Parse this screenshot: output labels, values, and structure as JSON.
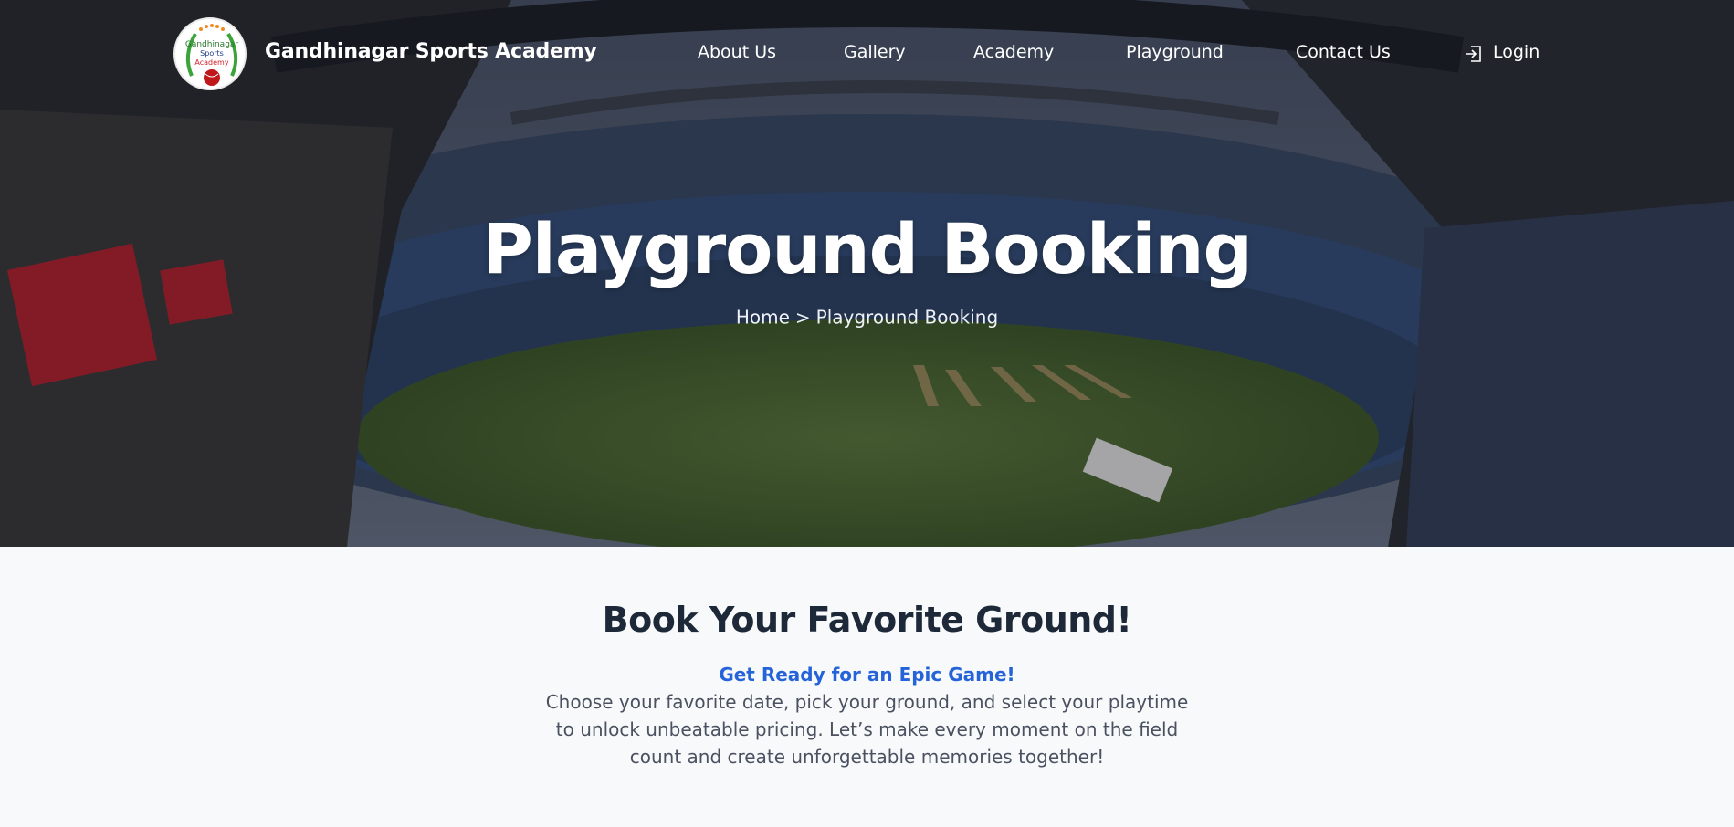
{
  "brand": {
    "name": "Gandhinagar Sports Academy",
    "logo_text": [
      "Gandhinagar",
      "Sports",
      "Academy"
    ]
  },
  "nav": {
    "items": [
      {
        "label": "About Us"
      },
      {
        "label": "Gallery"
      },
      {
        "label": "Academy"
      },
      {
        "label": "Playground"
      },
      {
        "label": "Contact Us"
      }
    ],
    "login": {
      "label": "Login",
      "icon": "login-icon"
    }
  },
  "hero": {
    "title": "Playground Booking",
    "breadcrumb": {
      "home": "Home",
      "separator": ">",
      "current": "Playground Booking"
    }
  },
  "intro": {
    "heading": "Book Your Favorite Ground!",
    "tagline": "Get Ready for an Epic Game!",
    "description": "Choose your favorite date, pick your ground, and select your playtime to unlock unbeatable pricing. Let’s make every moment on the field count and create unforgettable memories together!"
  },
  "colors": {
    "accent": "#2563d9",
    "heading": "#1d2838",
    "body_text": "#4a5160",
    "page_background": "#f8f9fb"
  }
}
